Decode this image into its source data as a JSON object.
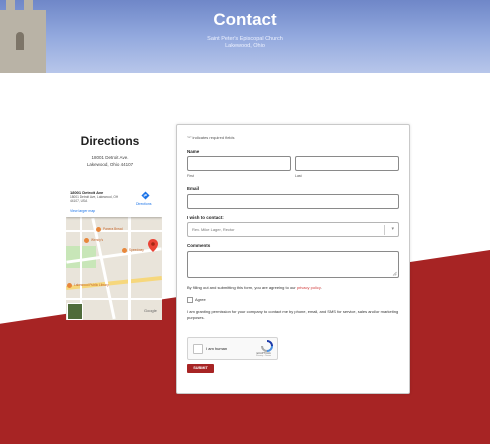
{
  "header": {
    "title": "Contact",
    "subtitle_line1": "Saint Peter's Episcopal Church",
    "subtitle_line2": "Lakewood, Ohio"
  },
  "directions": {
    "title": "Directions",
    "address_line1": "18001 Detroit Ave.",
    "address_line2": "Lakewood, Ohio 44107"
  },
  "map": {
    "place_name": "18001 Detroit Ave",
    "place_address": "18001 Detroit Ave, Lakewood, OH 44107, USA",
    "view_larger": "View larger map",
    "directions_label": "Directions",
    "google_label": "Google",
    "pois": [
      "Panera Bread",
      "Wendy's",
      "Speedway",
      "Lakewood Public Library"
    ]
  },
  "form": {
    "required_note": "\"*\" indicates required fields",
    "name_label": "Name",
    "first_sublabel": "First",
    "last_sublabel": "Last",
    "email_label": "Email",
    "contact_label": "I wish to contact:",
    "contact_selected": "Rev. Mike Lager, Rector",
    "comments_label": "Comments",
    "consent_pre": "By filling out and submitting this form, you are agreeing to our ",
    "consent_link": "privacy policy",
    "consent_post": ".",
    "agree_label": "Agree",
    "permission_text": "I am granting permission for your company to contact me by phone, email, and SMS for service, sales and/or marketing purposes.",
    "recaptcha_label": "I am human",
    "recaptcha_brand": "reCAPTCHA",
    "recaptcha_terms": "Privacy - Terms",
    "submit_label": "SUBMIT"
  },
  "colors": {
    "accent_red": "#a72424",
    "sky_blue": "#93a9de",
    "link_blue": "#1a73e8"
  }
}
